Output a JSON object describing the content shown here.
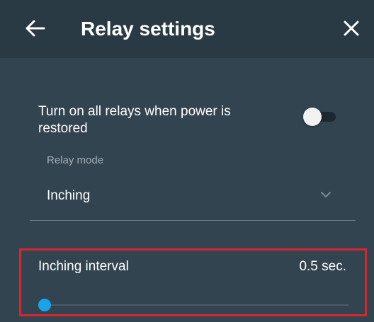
{
  "header": {
    "title": "Relay settings",
    "back_icon": "arrow-left-icon",
    "close_icon": "close-icon"
  },
  "power_restore": {
    "label": "Turn on all relays when power is restored",
    "enabled": false
  },
  "relay_mode": {
    "caption": "Relay mode",
    "value": "Inching",
    "icon": "chevron-down-icon"
  },
  "inching_interval": {
    "label": "Inching interval",
    "value_text": "0.5 sec.",
    "slider_fraction": 0.02
  },
  "colors": {
    "header_bg": "#293a45",
    "panel_bg": "#324450",
    "accent": "#1aa3e8",
    "highlight_border": "#d9262e"
  }
}
